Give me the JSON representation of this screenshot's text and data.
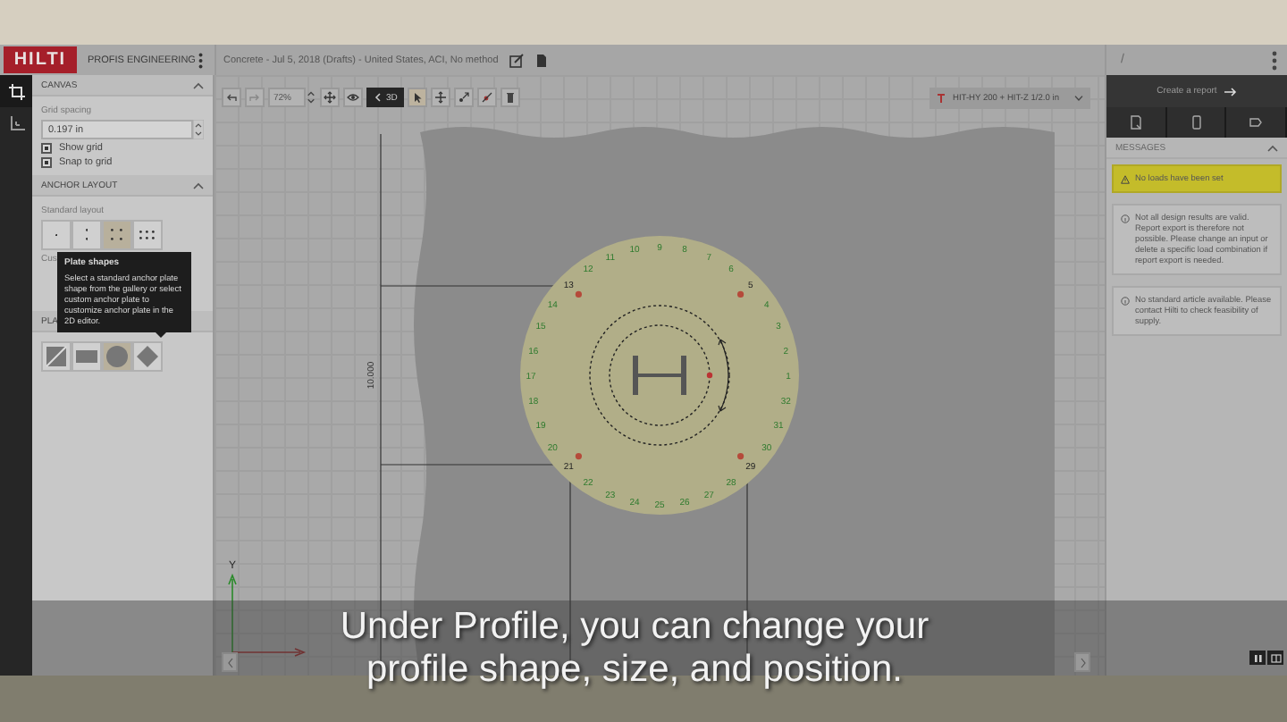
{
  "top_bar": {
    "logo": "HILTI",
    "app_name": "PROFIS ENGINEERING",
    "project_title": "Concrete - Jul 5, 2018 (Drafts) - United States, ACI, No method",
    "right_title": "/"
  },
  "side_tabs": [
    {
      "kind": "plate",
      "selected": true
    },
    {
      "kind": "axes",
      "selected": false
    }
  ],
  "canvas_section": {
    "title": "CANVAS",
    "expanded": true,
    "grid_spacing_label": "Grid spacing",
    "grid_spacing": "0.197 in",
    "checkboxes": [
      {
        "label": "Show grid",
        "checked": true
      },
      {
        "label": "Snap to grid",
        "checked": true
      }
    ]
  },
  "anchor_layout": {
    "title": "ANCHOR LAYOUT",
    "expanded": true,
    "standard_label": "Standard layout",
    "layouts": [
      {
        "kind": "one",
        "selected": false
      },
      {
        "kind": "two",
        "selected": false
      },
      {
        "kind": "four",
        "selected": true
      },
      {
        "kind": "six",
        "selected": false
      }
    ],
    "custom_label": "Cus"
  },
  "plate_shapes": {
    "title": "PLA",
    "shapes": [
      {
        "kind": "custom",
        "selected": false
      },
      {
        "kind": "rectangle",
        "selected": false
      },
      {
        "kind": "circle",
        "selected": true
      },
      {
        "kind": "diamond",
        "selected": false
      }
    ]
  },
  "tooltip": {
    "title": "Plate shapes",
    "text": "Select a standard anchor plate shape from the gallery or select custom anchor plate to customize anchor plate in the 2D editor."
  },
  "toolbar": {
    "zoom": "72%",
    "view_button": "3D",
    "anchor_dropdown": "HIT-HY 200 + HIT-Z 1/2.0 in"
  },
  "canvas": {
    "dimension": "10.000",
    "axis_label": "Y",
    "upper_holes": [
      {
        "label": "17",
        "anchor": false
      },
      {
        "label": "16",
        "anchor": false
      },
      {
        "label": "15",
        "anchor": false
      },
      {
        "label": "14",
        "anchor": false
      },
      {
        "label": "13",
        "anchor": true
      },
      {
        "label": "12",
        "anchor": false
      },
      {
        "label": "11",
        "anchor": false
      },
      {
        "label": "10",
        "anchor": false
      },
      {
        "label": "9",
        "anchor": false
      },
      {
        "label": "8",
        "anchor": false
      },
      {
        "label": "7",
        "anchor": false
      },
      {
        "label": "6",
        "anchor": false
      },
      {
        "label": "5",
        "anchor": true
      },
      {
        "label": "4",
        "anchor": false
      },
      {
        "label": "3",
        "anchor": false
      },
      {
        "label": "2",
        "anchor": false
      },
      {
        "label": "1",
        "anchor": false
      }
    ],
    "lower_holes": [
      {
        "label": "18",
        "anchor": false
      },
      {
        "label": "19",
        "anchor": false
      },
      {
        "label": "20",
        "anchor": false
      },
      {
        "label": "21",
        "anchor": true
      },
      {
        "label": "22",
        "anchor": false
      },
      {
        "label": "23",
        "anchor": false
      },
      {
        "label": "24",
        "anchor": false
      },
      {
        "label": "25",
        "anchor": false
      },
      {
        "label": "26",
        "anchor": false
      },
      {
        "label": "27",
        "anchor": false
      },
      {
        "label": "28",
        "anchor": false
      },
      {
        "label": "29",
        "anchor": true
      },
      {
        "label": "30",
        "anchor": false
      },
      {
        "label": "31",
        "anchor": false
      },
      {
        "label": "32",
        "anchor": false
      }
    ]
  },
  "right_panel": {
    "report_button": "Create a report",
    "tabs": [
      {
        "kind": "export",
        "selected": false
      },
      {
        "kind": "device",
        "selected": false
      },
      {
        "kind": "tag",
        "selected": false
      }
    ],
    "messages_title": "MESSAGES",
    "expanded": true,
    "messages": [
      {
        "kind": "warning",
        "text": "No loads have been set"
      },
      {
        "kind": "info",
        "text": "Not all design results are valid. Report export is therefore not possible. Please change an input or delete a specific load combination if report export is needed."
      },
      {
        "kind": "info",
        "text": "No standard article available. Please contact Hilti to check feasibility of supply."
      }
    ]
  },
  "subtitle": "Under Profile, you can change your profile shape, size, and position."
}
